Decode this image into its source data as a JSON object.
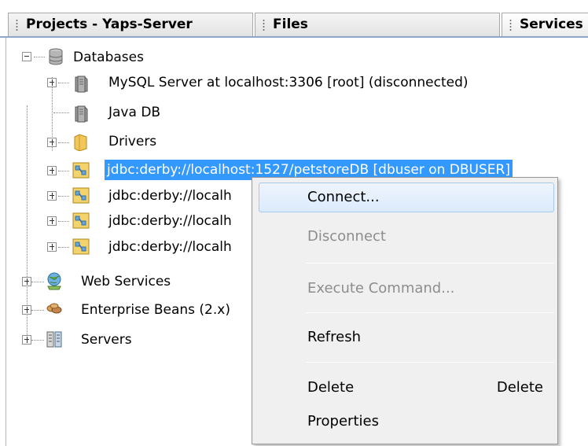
{
  "tabs": [
    {
      "label": "Projects - Yaps-Server",
      "active": false
    },
    {
      "label": "Files",
      "active": false
    },
    {
      "label": "Services",
      "active": true
    }
  ],
  "tree": {
    "databases": {
      "label": "Databases",
      "icon": "database-icon",
      "expanded": true
    },
    "mysql": {
      "label": "MySQL Server at localhost:3306 [root] (disconnected)",
      "icon": "db-server-icon"
    },
    "javadb": {
      "label": "Java DB",
      "icon": "db-server-icon"
    },
    "drivers": {
      "label": "Drivers",
      "icon": "folder-icon"
    },
    "connections": [
      {
        "label": "jdbc:derby://localhost:1527/petstoreDB [dbuser on DBUSER]",
        "selected": true
      },
      {
        "label": "jdbc:derby://localh",
        "selected": false
      },
      {
        "label": "jdbc:derby://localh",
        "selected": false
      },
      {
        "label": "jdbc:derby://localh",
        "selected": false
      }
    ],
    "web_services": {
      "label": "Web Services",
      "icon": "globe-icon"
    },
    "enterprise_beans": {
      "label": "Enterprise Beans (2.x)",
      "icon": "beans-icon"
    },
    "servers": {
      "label": "Servers",
      "icon": "server-icon"
    }
  },
  "context_menu": {
    "items": [
      {
        "label": "Connect...",
        "enabled": true,
        "highlighted": true
      },
      {
        "label": "Disconnect",
        "enabled": false
      },
      {
        "label": "Execute Command...",
        "enabled": false
      },
      {
        "label": "Refresh",
        "enabled": true
      },
      {
        "label": "Delete",
        "accelerator": "Delete",
        "enabled": true
      },
      {
        "label": "Properties",
        "enabled": true
      }
    ]
  },
  "colors": {
    "selection": "#3399ff",
    "menu_background": "#f0f0f0",
    "disabled_text": "#8d8d8d"
  }
}
